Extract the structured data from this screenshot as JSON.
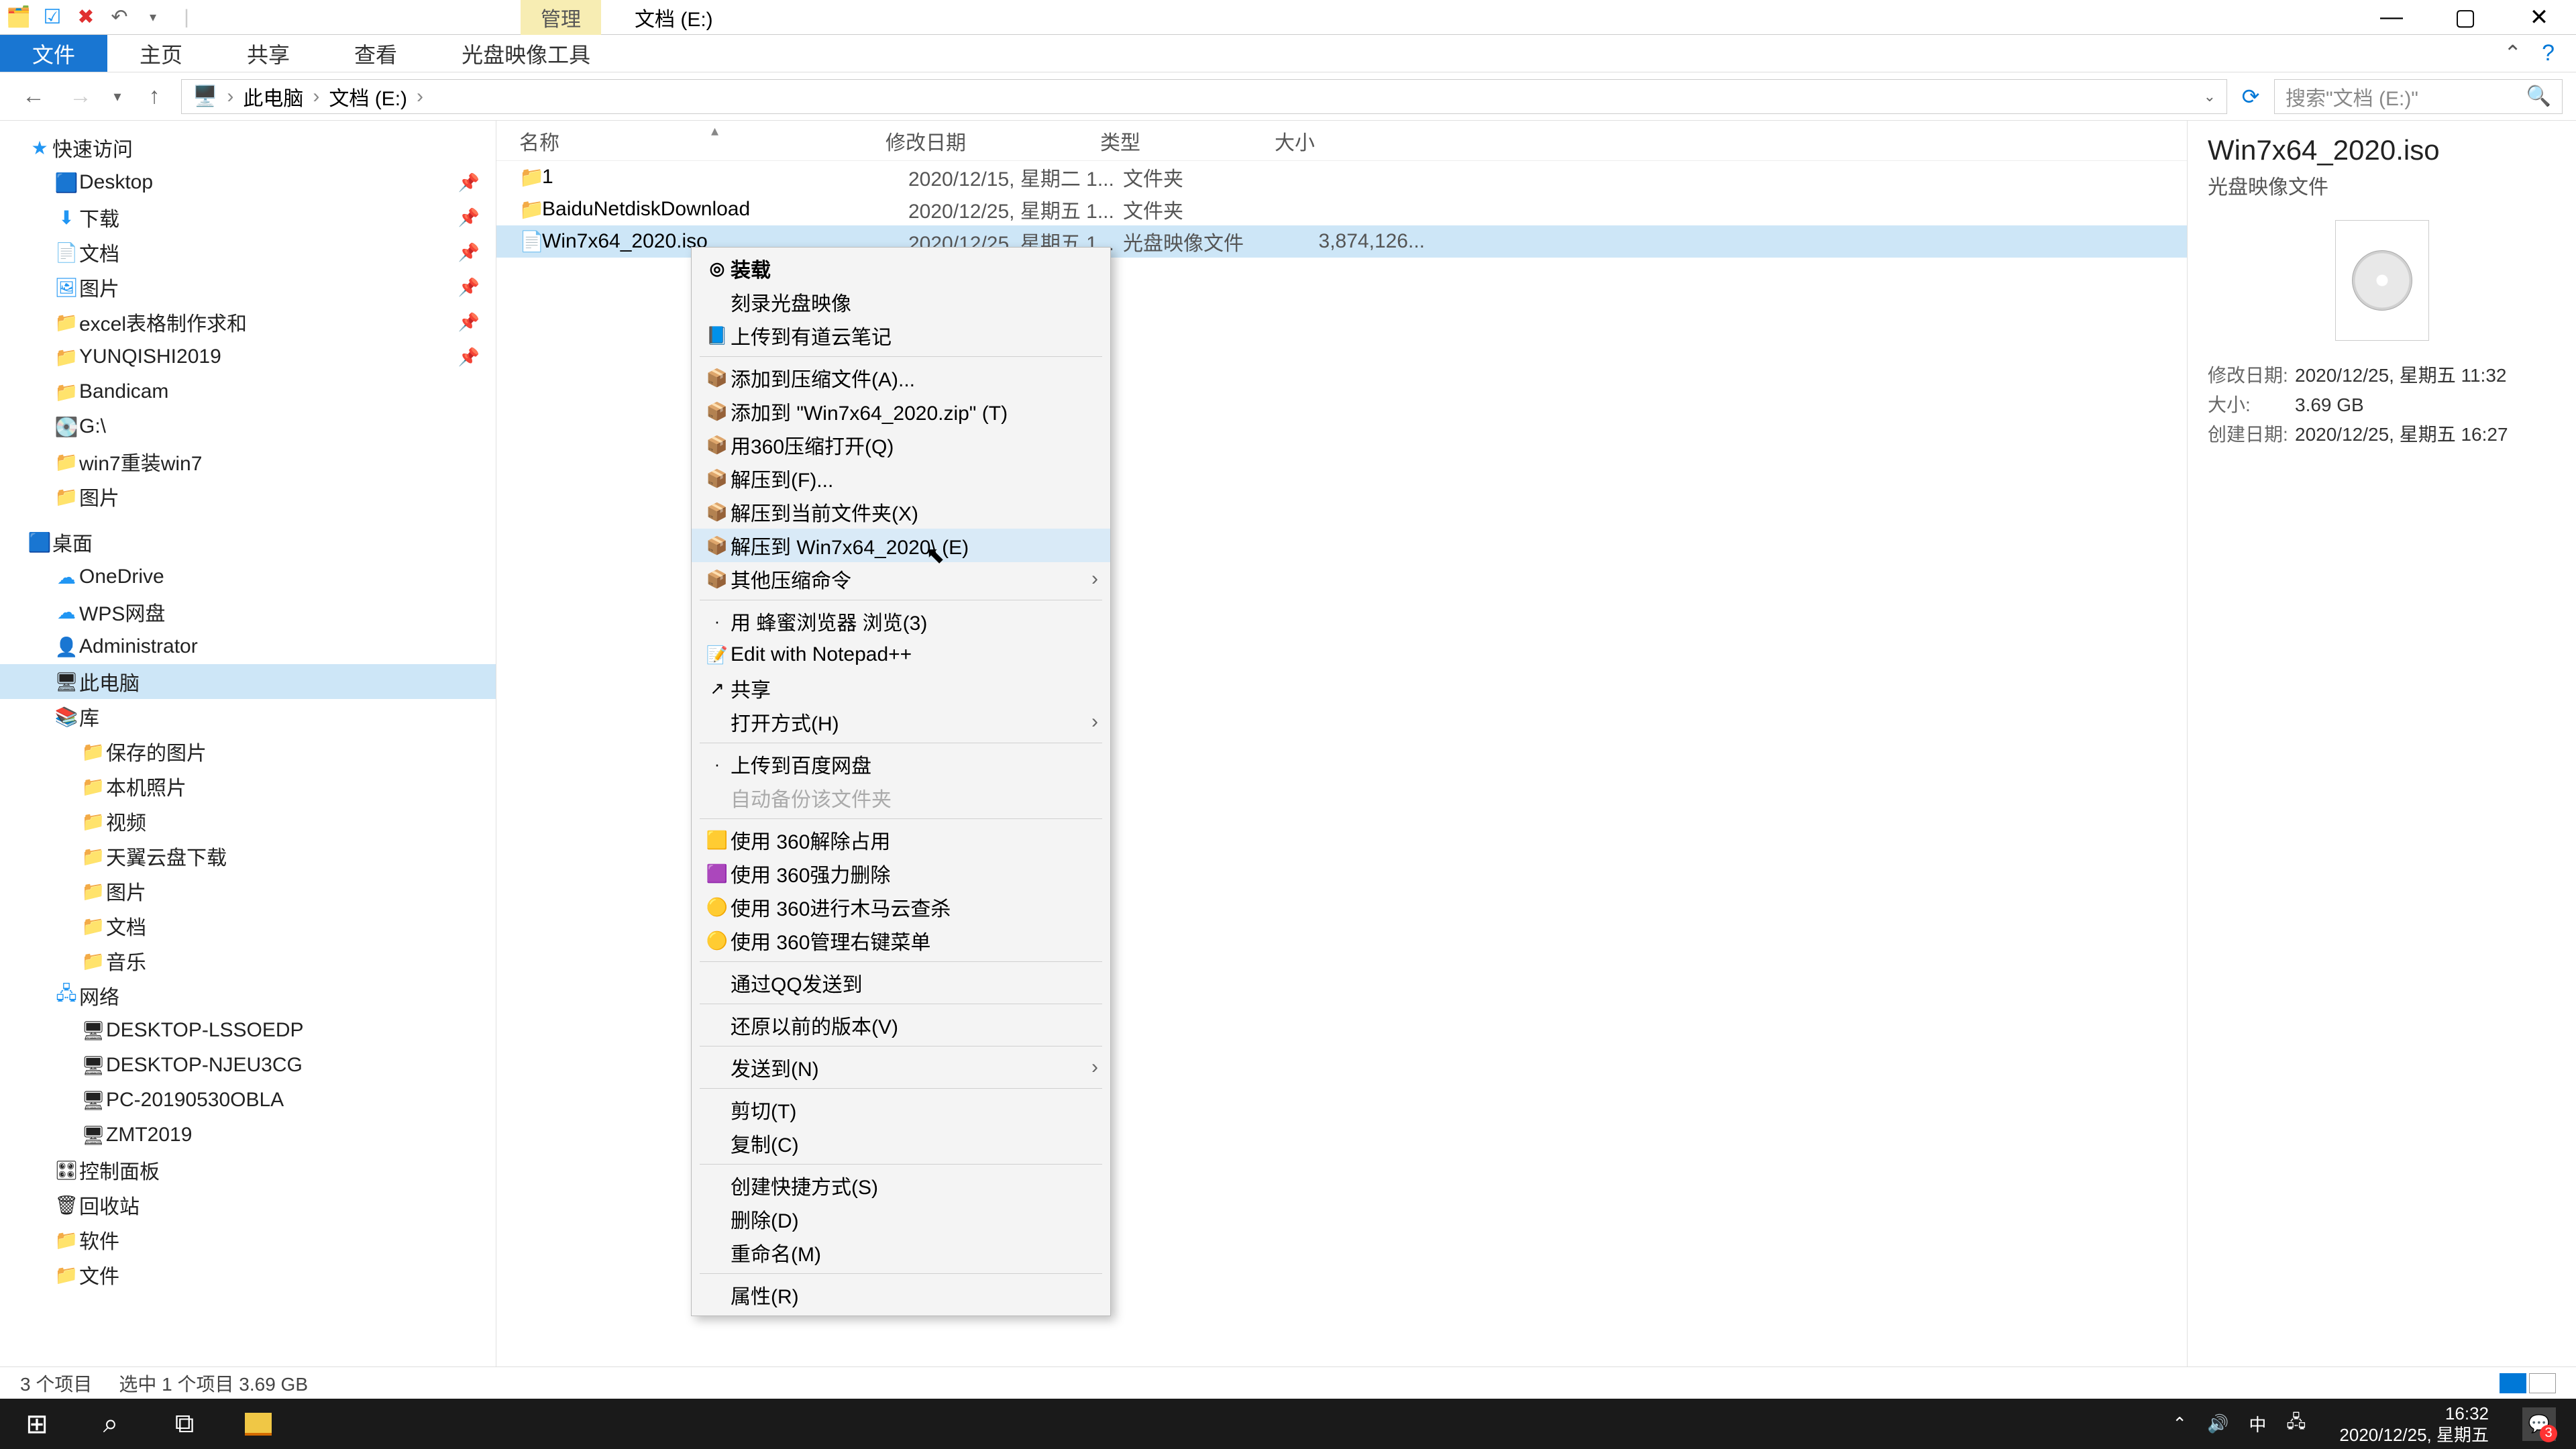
{
  "titlebar": {
    "manage_tab": "管理",
    "title": "文档 (E:)"
  },
  "ribbon": {
    "file": "文件",
    "home": "主页",
    "share": "共享",
    "view": "查看",
    "disc_tools": "光盘映像工具"
  },
  "breadcrumb": {
    "this_pc": "此电脑",
    "docs": "文档 (E:)"
  },
  "search": {
    "placeholder": "搜索\"文档 (E:)\""
  },
  "tree": {
    "quick": "快速访问",
    "desktop": "Desktop",
    "downloads": "下载",
    "documents": "文档",
    "pictures": "图片",
    "excel": "excel表格制作求和",
    "yunqishi": "YUNQISHI2019",
    "bandicam": "Bandicam",
    "g_drive": "G:\\",
    "win7reinstall": "win7重装win7",
    "pictures2": "图片",
    "desktop2": "桌面",
    "onedrive": "OneDrive",
    "wps": "WPS网盘",
    "admin": "Administrator",
    "this_pc": "此电脑",
    "libraries": "库",
    "saved_pics": "保存的图片",
    "local_pics": "本机照片",
    "videos": "视频",
    "tianyi": "天翼云盘下载",
    "pics3": "图片",
    "docs2": "文档",
    "music": "音乐",
    "network": "网络",
    "pc1": "DESKTOP-LSSOEDP",
    "pc2": "DESKTOP-NJEU3CG",
    "pc3": "PC-20190530OBLA",
    "pc4": "ZMT2019",
    "ctrlpanel": "控制面板",
    "recycle": "回收站",
    "software": "软件",
    "files": "文件"
  },
  "columns": {
    "name": "名称",
    "date": "修改日期",
    "type": "类型",
    "size": "大小"
  },
  "rows": [
    {
      "name": "1",
      "date": "2020/12/15, 星期二 1...",
      "type": "文件夹",
      "size": "",
      "icon": "📁"
    },
    {
      "name": "BaiduNetdiskDownload",
      "date": "2020/12/25, 星期五 1...",
      "type": "文件夹",
      "size": "",
      "icon": "📁"
    },
    {
      "name": "Win7x64_2020.iso",
      "date": "2020/12/25, 星期五 1...",
      "type": "光盘映像文件",
      "size": "3,874,126...",
      "icon": "📄"
    }
  ],
  "preview": {
    "title": "Win7x64_2020.iso",
    "subtitle": "光盘映像文件",
    "mod_label": "修改日期:",
    "mod_value": "2020/12/25, 星期五 11:32",
    "size_label": "大小:",
    "size_value": "3.69 GB",
    "create_label": "创建日期:",
    "create_value": "2020/12/25, 星期五 16:27"
  },
  "context": [
    {
      "label": "装载",
      "bold": true,
      "icon": "◎"
    },
    {
      "label": "刻录光盘映像"
    },
    {
      "label": "上传到有道云笔记",
      "icon": "📘"
    },
    {
      "sep": true
    },
    {
      "label": "添加到压缩文件(A)...",
      "icon": "📦"
    },
    {
      "label": "添加到 \"Win7x64_2020.zip\" (T)",
      "icon": "📦"
    },
    {
      "label": "用360压缩打开(Q)",
      "icon": "📦"
    },
    {
      "label": "解压到(F)...",
      "icon": "📦"
    },
    {
      "label": "解压到当前文件夹(X)",
      "icon": "📦"
    },
    {
      "label": "解压到 Win7x64_2020\\ (E)",
      "icon": "📦",
      "hover": true
    },
    {
      "label": "其他压缩命令",
      "icon": "📦",
      "sub": true
    },
    {
      "sep": true
    },
    {
      "label": "用 蜂蜜浏览器 浏览(3)",
      "icon": "·"
    },
    {
      "label": "Edit with Notepad++",
      "icon": "📝"
    },
    {
      "label": "共享",
      "icon": "↗"
    },
    {
      "label": "打开方式(H)",
      "sub": true
    },
    {
      "sep": true
    },
    {
      "label": "上传到百度网盘",
      "icon": "·"
    },
    {
      "label": "自动备份该文件夹",
      "disabled": true
    },
    {
      "sep": true
    },
    {
      "label": "使用 360解除占用",
      "icon": "🟨"
    },
    {
      "label": "使用 360强力删除",
      "icon": "🟪"
    },
    {
      "label": "使用 360进行木马云查杀",
      "icon": "🟡"
    },
    {
      "label": "使用 360管理右键菜单",
      "icon": "🟡"
    },
    {
      "sep": true
    },
    {
      "label": "通过QQ发送到"
    },
    {
      "sep": true
    },
    {
      "label": "还原以前的版本(V)"
    },
    {
      "sep": true
    },
    {
      "label": "发送到(N)",
      "sub": true
    },
    {
      "sep": true
    },
    {
      "label": "剪切(T)"
    },
    {
      "label": "复制(C)"
    },
    {
      "sep": true
    },
    {
      "label": "创建快捷方式(S)"
    },
    {
      "label": "删除(D)"
    },
    {
      "label": "重命名(M)"
    },
    {
      "sep": true
    },
    {
      "label": "属性(R)"
    }
  ],
  "status": {
    "count": "3 个项目",
    "selected": "选中 1 个项目  3.69 GB"
  },
  "taskbar": {
    "ime": "中",
    "time": "16:32",
    "date": "2020/12/25, 星期五",
    "notif_count": "3"
  }
}
